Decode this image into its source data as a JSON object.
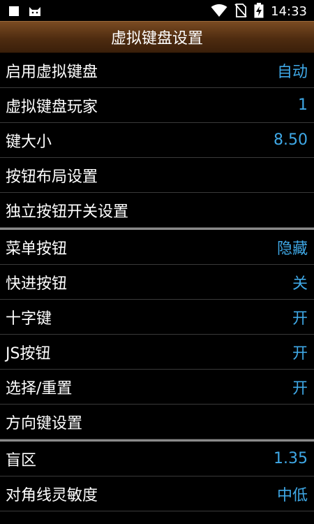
{
  "status_bar": {
    "time": "14:33",
    "icons": [
      "square-notification-icon",
      "cat-notification-icon",
      "wifi-icon",
      "no-sim-icon",
      "battery-charging-icon"
    ]
  },
  "header": {
    "title": "虚拟键盘设置"
  },
  "sections": [
    {
      "items": [
        {
          "label": "启用虚拟键盘",
          "value": "自动"
        },
        {
          "label": "虚拟键盘玩家",
          "value": "1"
        },
        {
          "label": "键大小",
          "value": "8.50"
        },
        {
          "label": "按钮布局设置",
          "value": ""
        },
        {
          "label": "独立按钮开关设置",
          "value": ""
        }
      ]
    },
    {
      "items": [
        {
          "label": "菜单按钮",
          "value": "隐藏"
        },
        {
          "label": "快进按钮",
          "value": "关"
        },
        {
          "label": "十字键",
          "value": "开"
        },
        {
          "label": "JS按钮",
          "value": "开"
        },
        {
          "label": "选择/重置",
          "value": "开"
        },
        {
          "label": "方向键设置",
          "value": ""
        }
      ]
    },
    {
      "items": [
        {
          "label": "盲区",
          "value": "1.35"
        },
        {
          "label": "对角线灵敏度",
          "value": "中低"
        }
      ]
    }
  ],
  "colors": {
    "value_accent": "#3fa8e6",
    "title_bar": "#5a3414",
    "background": "#000000"
  }
}
